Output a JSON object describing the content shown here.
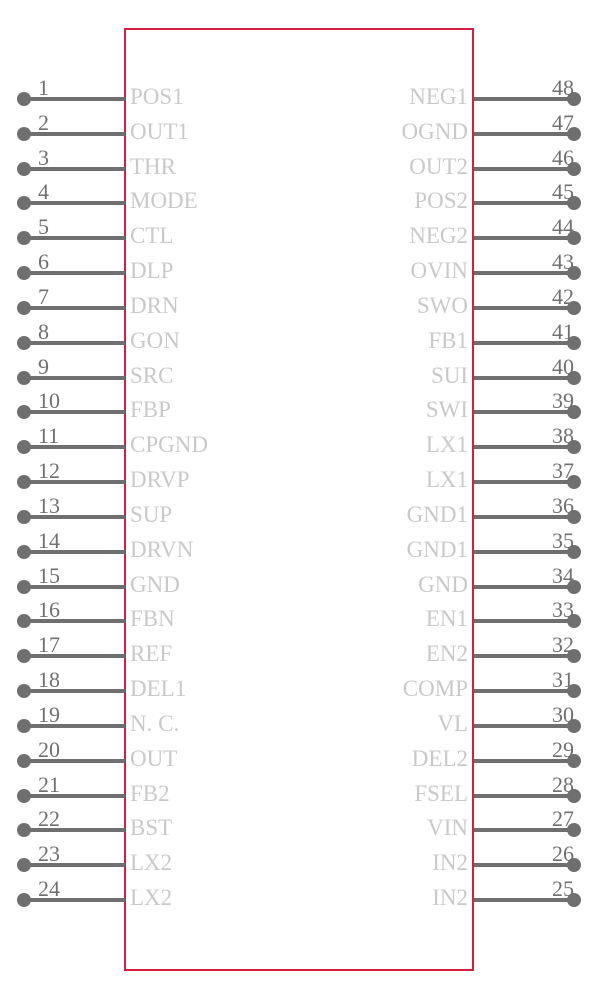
{
  "symbol": {
    "outline_color": "#d41f3f",
    "pin_color": "#6f6f6f",
    "label_color": "#c9c9c9",
    "number_color": "#707070",
    "left_pins": [
      {
        "number": "1",
        "label": "POS1"
      },
      {
        "number": "2",
        "label": "OUT1"
      },
      {
        "number": "3",
        "label": "THR"
      },
      {
        "number": "4",
        "label": "MODE"
      },
      {
        "number": "5",
        "label": "CTL"
      },
      {
        "number": "6",
        "label": "DLP"
      },
      {
        "number": "7",
        "label": "DRN"
      },
      {
        "number": "8",
        "label": "GON"
      },
      {
        "number": "9",
        "label": "SRC"
      },
      {
        "number": "10",
        "label": "FBP"
      },
      {
        "number": "11",
        "label": "CPGND"
      },
      {
        "number": "12",
        "label": "DRVP"
      },
      {
        "number": "13",
        "label": "SUP"
      },
      {
        "number": "14",
        "label": "DRVN"
      },
      {
        "number": "15",
        "label": "GND"
      },
      {
        "number": "16",
        "label": "FBN"
      },
      {
        "number": "17",
        "label": "REF"
      },
      {
        "number": "18",
        "label": "DEL1"
      },
      {
        "number": "19",
        "label": "N. C."
      },
      {
        "number": "20",
        "label": "OUT"
      },
      {
        "number": "21",
        "label": "FB2"
      },
      {
        "number": "22",
        "label": "BST"
      },
      {
        "number": "23",
        "label": "LX2"
      },
      {
        "number": "24",
        "label": "LX2"
      }
    ],
    "right_pins": [
      {
        "number": "48",
        "label": "NEG1"
      },
      {
        "number": "47",
        "label": "OGND"
      },
      {
        "number": "46",
        "label": "OUT2"
      },
      {
        "number": "45",
        "label": "POS2"
      },
      {
        "number": "44",
        "label": "NEG2"
      },
      {
        "number": "43",
        "label": "OVIN"
      },
      {
        "number": "42",
        "label": "SWO"
      },
      {
        "number": "41",
        "label": "FB1"
      },
      {
        "number": "40",
        "label": "SUI"
      },
      {
        "number": "39",
        "label": "SWI"
      },
      {
        "number": "38",
        "label": "LX1"
      },
      {
        "number": "37",
        "label": "LX1"
      },
      {
        "number": "36",
        "label": "GND1"
      },
      {
        "number": "35",
        "label": "GND1"
      },
      {
        "number": "34",
        "label": "GND"
      },
      {
        "number": "33",
        "label": "EN1"
      },
      {
        "number": "32",
        "label": "EN2"
      },
      {
        "number": "31",
        "label": "COMP"
      },
      {
        "number": "30",
        "label": "VL"
      },
      {
        "number": "29",
        "label": "DEL2"
      },
      {
        "number": "28",
        "label": "FSEL"
      },
      {
        "number": "27",
        "label": "VIN"
      },
      {
        "number": "26",
        "label": "IN2"
      },
      {
        "number": "25",
        "label": "IN2"
      }
    ]
  }
}
